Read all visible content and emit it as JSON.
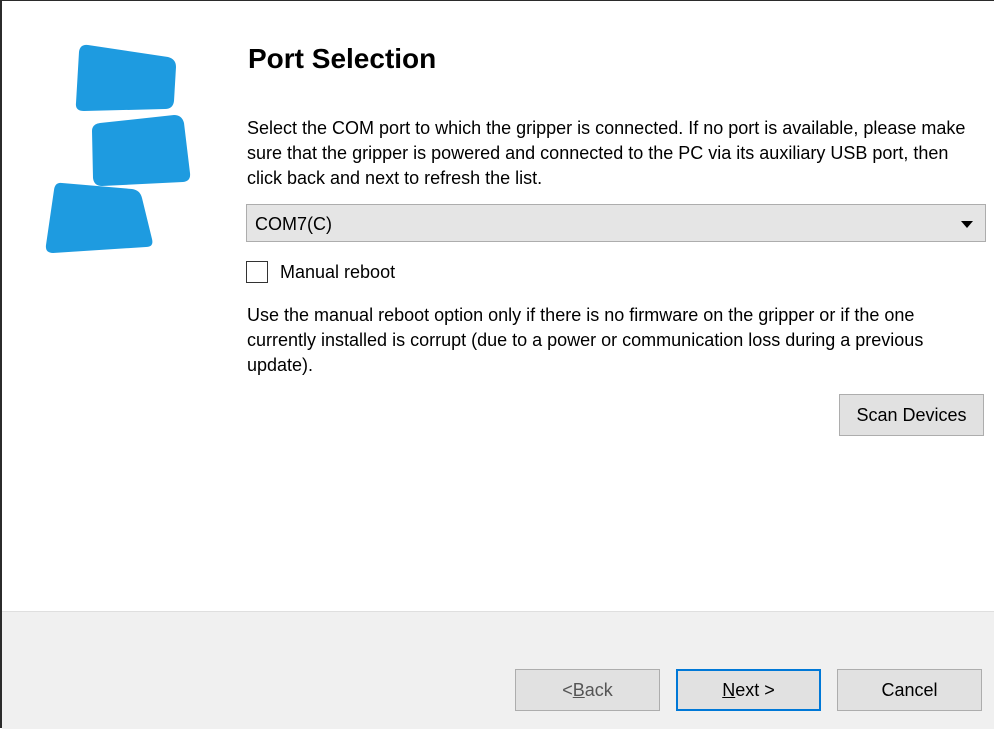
{
  "page": {
    "title": "Port Selection",
    "description": "Select the COM port to which the gripper is connected. If no port is available, please make sure that the gripper is powered and connected to the PC via its auxiliary USB port, then click back and next to refresh the list."
  },
  "port_select": {
    "selected": "COM7(C)"
  },
  "manual_reboot": {
    "label": "Manual reboot",
    "checked": false
  },
  "note": "Use the manual reboot option only if there is no firmware on the gripper or if the one currently installed is corrupt (due to a power or communication loss during a previous update).",
  "buttons": {
    "scan": "Scan Devices",
    "back_prefix": "< ",
    "back_mnemonic": "B",
    "back_rest": "ack",
    "next_mnemonic": "N",
    "next_rest": "ext >",
    "cancel": "Cancel"
  },
  "colors": {
    "logo_blue": "#1e9be0",
    "focus_border": "#0078d7",
    "footer_bg": "#f0f0f0"
  }
}
